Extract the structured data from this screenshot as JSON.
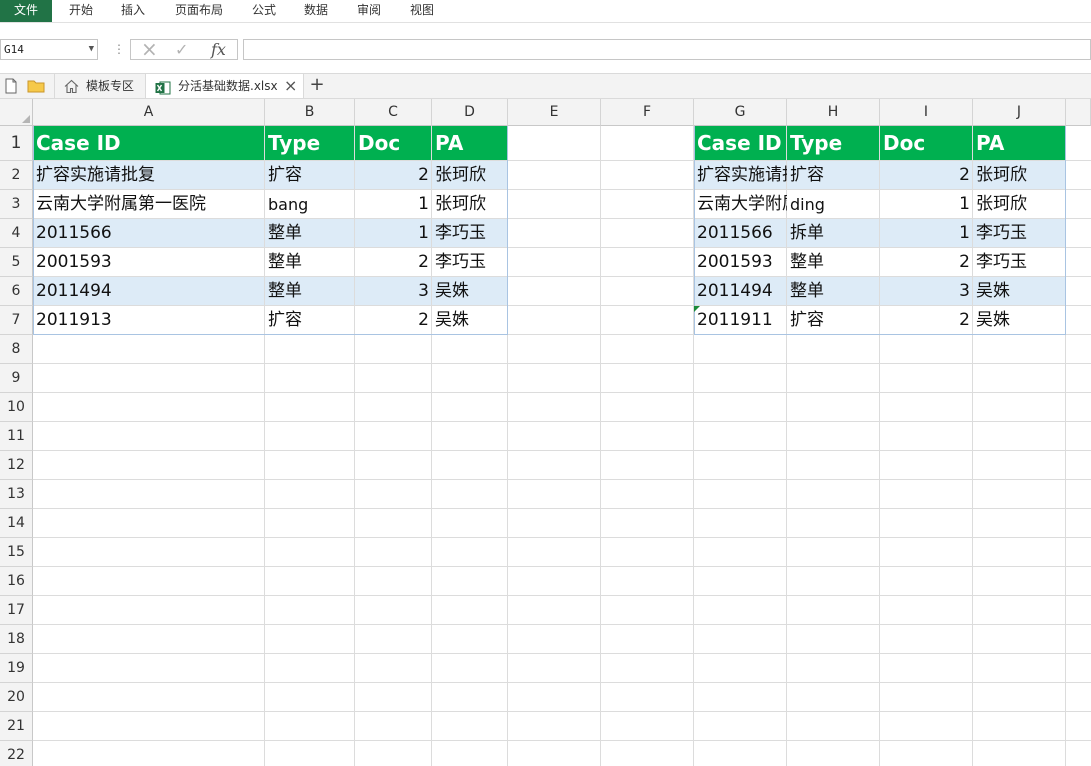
{
  "ribbon": {
    "tabs": [
      "文件",
      "开始",
      "插入",
      "页面布局",
      "公式",
      "数据",
      "审阅",
      "视图"
    ],
    "tab_x": [
      0,
      69,
      121,
      175,
      252,
      304,
      357,
      410
    ],
    "file_color": "#217346"
  },
  "formula_bar": {
    "name_box": "G14",
    "cancel_icon": "×",
    "enter_icon": "✓",
    "function_icon": "fx",
    "value": ""
  },
  "tab_strip": {
    "tabs": [
      {
        "label": "模板专区",
        "active": false
      },
      {
        "label": "分活基础数据.xlsx",
        "active": true
      }
    ],
    "close_icon": "×",
    "new_tab_icon": "+"
  },
  "columns": [
    "A",
    "B",
    "C",
    "D",
    "E",
    "F",
    "G",
    "H",
    "I",
    "J"
  ],
  "rows": [
    "1",
    "2",
    "3",
    "4",
    "5",
    "6",
    "7",
    "8",
    "9",
    "10",
    "11",
    "12",
    "13",
    "14",
    "15",
    "16",
    "17",
    "18",
    "19",
    "20",
    "21",
    "22"
  ],
  "table_left": {
    "headers": [
      "Case ID",
      "Type",
      "Doc",
      "PA"
    ],
    "rows": [
      [
        "扩容实施请批复",
        "扩容",
        "2",
        "张珂欣"
      ],
      [
        "云南大学附属第一医院",
        "bang",
        "1",
        "张珂欣"
      ],
      [
        "2011566",
        "整单",
        "1",
        "李巧玉"
      ],
      [
        "2001593",
        "整单",
        "2",
        "李巧玉"
      ],
      [
        "2011494",
        "整单",
        "3",
        "吴姝"
      ],
      [
        "2011913",
        "扩容",
        "2",
        "吴姝"
      ]
    ]
  },
  "table_right": {
    "headers": [
      "Case ID",
      "Type",
      "Doc",
      "PA"
    ],
    "rows": [
      [
        "扩容实施请批复",
        "扩容",
        "2",
        "张珂欣"
      ],
      [
        "云南大学附属第一医院",
        "ding",
        "1",
        "张珂欣"
      ],
      [
        "2011566",
        "拆单",
        "1",
        "李巧玉"
      ],
      [
        "2001593",
        "整单",
        "2",
        "李巧玉"
      ],
      [
        "2011494",
        "整单",
        "3",
        "吴姝"
      ],
      [
        "2011911",
        "扩容",
        "2",
        "吴姝"
      ]
    ]
  },
  "colors": {
    "header_green": "#00b050",
    "band_blue": "#ddebf7",
    "excel_green": "#217346"
  }
}
